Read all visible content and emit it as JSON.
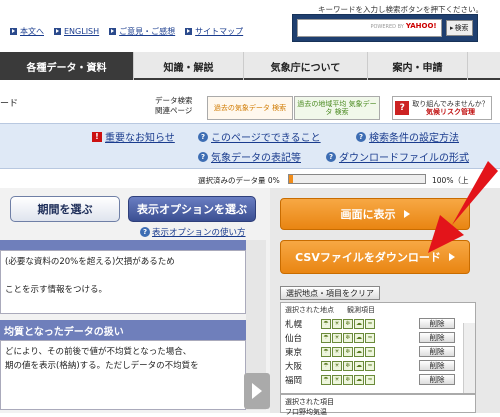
{
  "top_links": [
    "本文へ",
    "ENGLISH",
    "ご意見・ご感想",
    "サイトマップ"
  ],
  "search": {
    "hint": "キーワードを入力し検索ボタンを押下ください。",
    "powered_by": "POWERED BY",
    "provider": "YAHOO!",
    "button": "検索"
  },
  "nav": [
    "各種データ・資料",
    "知識・解説",
    "気象庁について",
    "案内・申請"
  ],
  "page_rule_fragment": "ード",
  "related": {
    "label_line1": "データ検索",
    "label_line2": "関連ページ"
  },
  "banners": {
    "b1": "過去の気象データ 検索",
    "b2": "過去の地域平均 気象データ 検索",
    "b3_line1": "取り組んでみませんか？",
    "b3_line2": "気候リスク管理"
  },
  "info_links": {
    "important": "重要なお知らせ",
    "this_page": "このページでできること",
    "search_settings": "検索条件の設定方法",
    "notation": "気象データの表記等",
    "download_format": "ダウンロードファイルの形式"
  },
  "data_amount": {
    "label": "選択済みのデータ量",
    "min": "0%",
    "max": "100%（上",
    "fraction": 0.03
  },
  "left": {
    "period_button": "期間を選ぶ",
    "option_button": "表示オプションを選ぶ",
    "option_usage": "表示オプションの使い方",
    "body1_line1": "(必要な資料の20%を超える)欠損があるため",
    "body1_line2": "ことを示す情報をつける。",
    "section2_title": "均質となったデータの扱い",
    "body2_line1": "どにより、その前後で値が不均質となった場合、",
    "body2_line2": "期の値を表示(格納)する。ただしデータの不均質を"
  },
  "right": {
    "show_button": "画面に表示",
    "csv_button": "CSVファイルをダウンロード",
    "clear_button": "選択地点・項目をクリア",
    "col_stations": "選択された地点",
    "col_items": "観測項目",
    "stations": [
      "札幌",
      "仙台",
      "東京",
      "大阪",
      "福岡"
    ],
    "delete_label": "削除",
    "selected_items_header": "選択された項目",
    "selected_item_fragment": "フ口野均気温"
  },
  "colors": {
    "accent_orange": "#e98512",
    "nav_active": "#3a3a3a",
    "arrow_red": "#e3141a"
  }
}
